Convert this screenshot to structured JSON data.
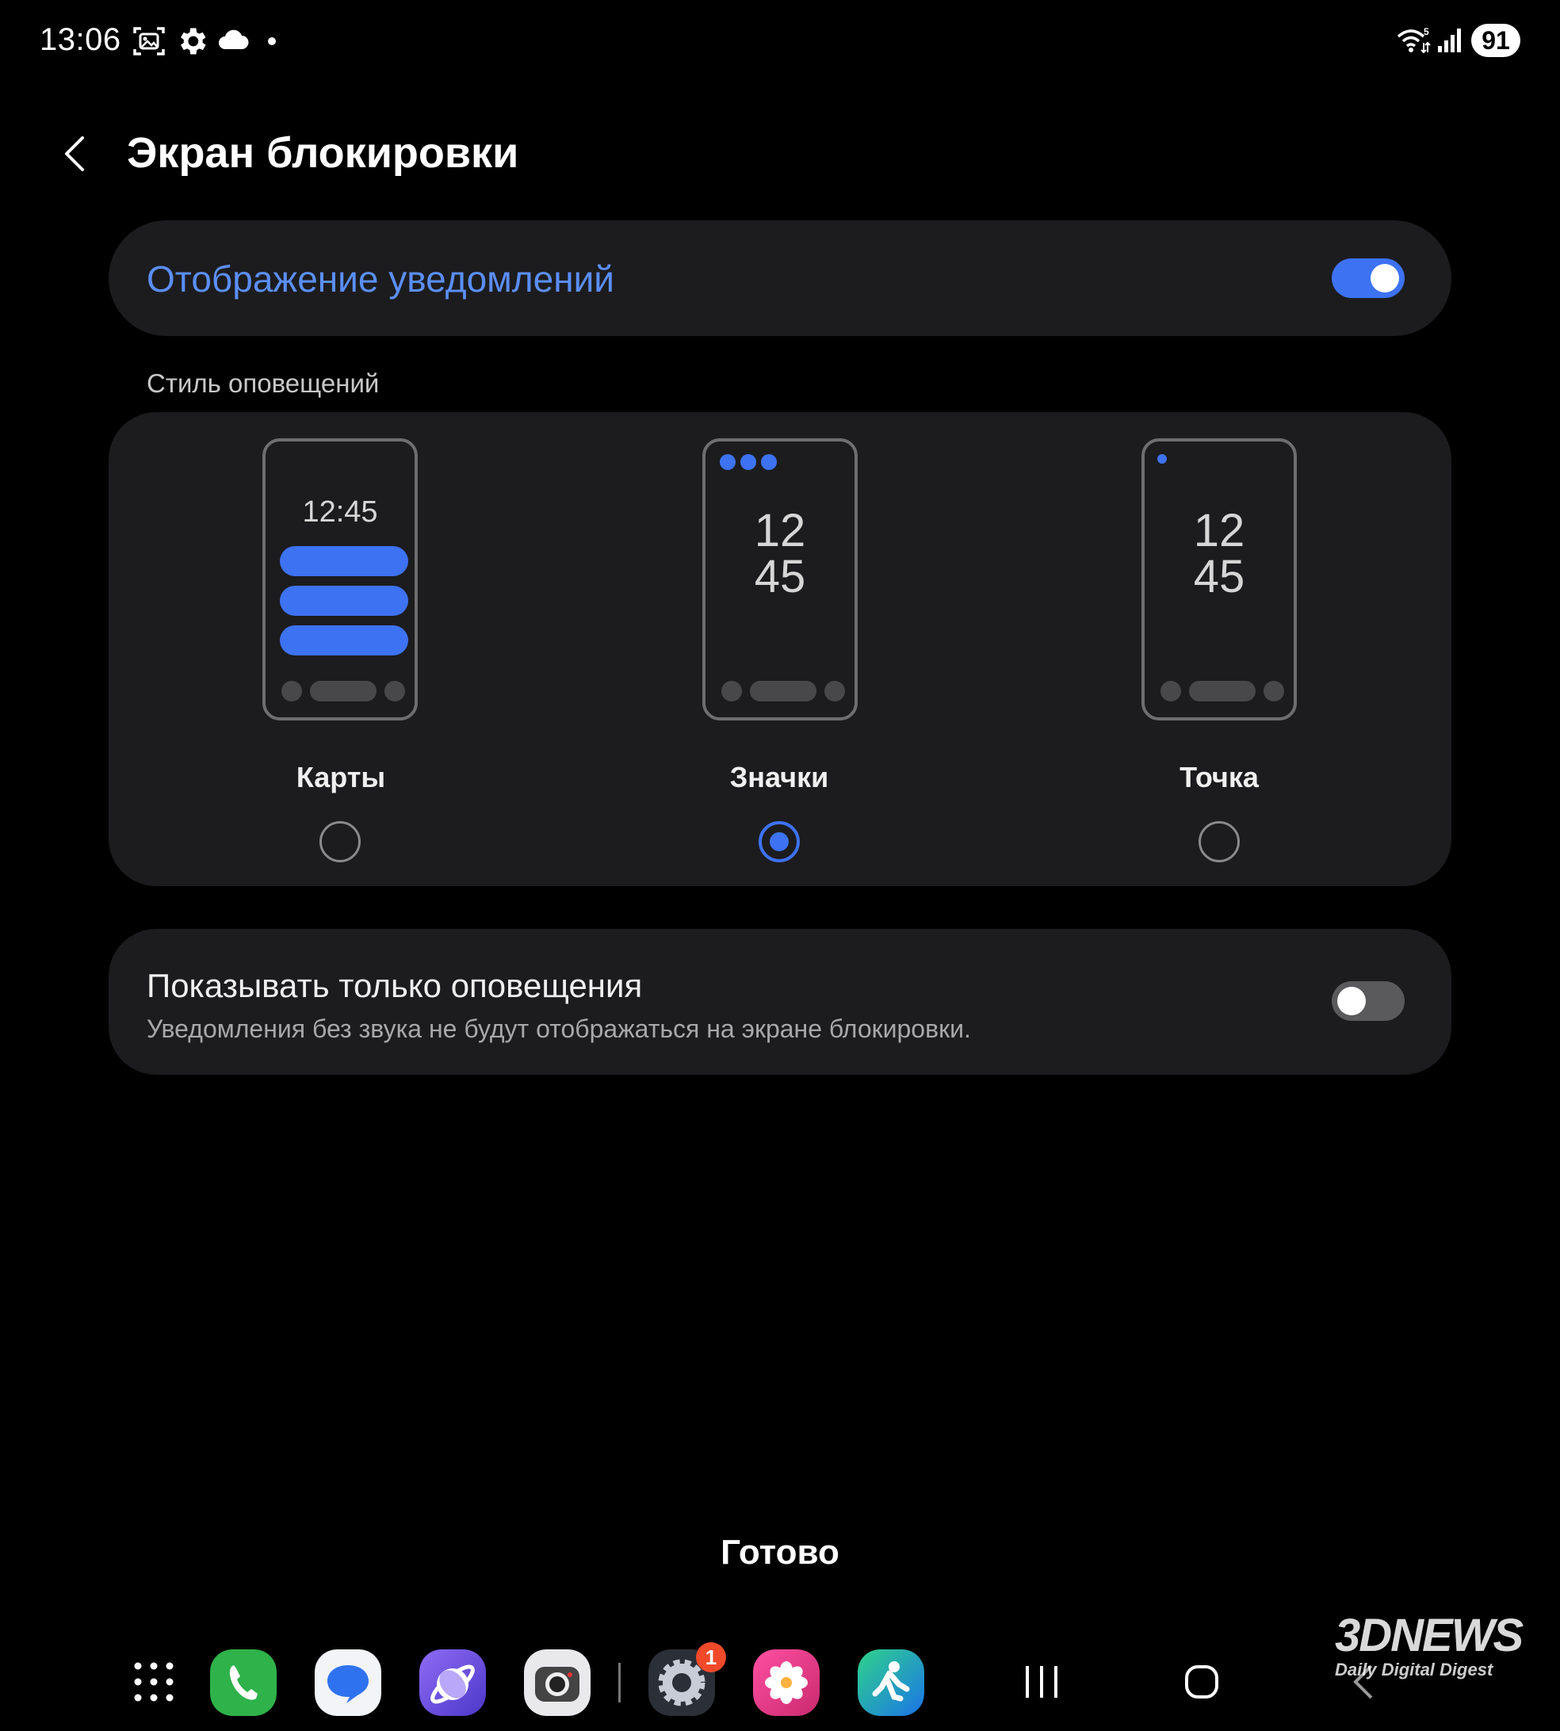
{
  "status_bar": {
    "time": "13:06",
    "battery": "91"
  },
  "header": {
    "title": "Экран блокировки"
  },
  "notifications": {
    "label": "Отображение уведомлений",
    "enabled": true
  },
  "style_section": {
    "heading": "Стиль оповещений",
    "options": [
      {
        "label": "Карты",
        "preview_time": "12:45",
        "selected": false
      },
      {
        "label": "Значки",
        "preview_hours": "12",
        "preview_minutes": "45",
        "selected": true
      },
      {
        "label": "Точка",
        "preview_hours": "12",
        "preview_minutes": "45",
        "selected": false
      }
    ]
  },
  "alerts_only": {
    "title": "Показывать только оповещения",
    "subtitle": "Уведомления без звука не будут отображаться на экране блокировки.",
    "enabled": false
  },
  "done_label": "Готово",
  "dock": {
    "apps": [
      "apps-grid-icon",
      "phone-icon",
      "messages-icon",
      "internet-icon",
      "camera-icon",
      "settings-icon",
      "gallery-icon",
      "bixby-icon"
    ],
    "settings_badge": "1"
  },
  "watermark": {
    "logo": "3DNEWS",
    "tagline": "Daily Digital Digest"
  },
  "colors": {
    "accent": "#3d72f3",
    "link": "#5b8ef7",
    "card": "#1c1c1e",
    "background": "#000000"
  }
}
